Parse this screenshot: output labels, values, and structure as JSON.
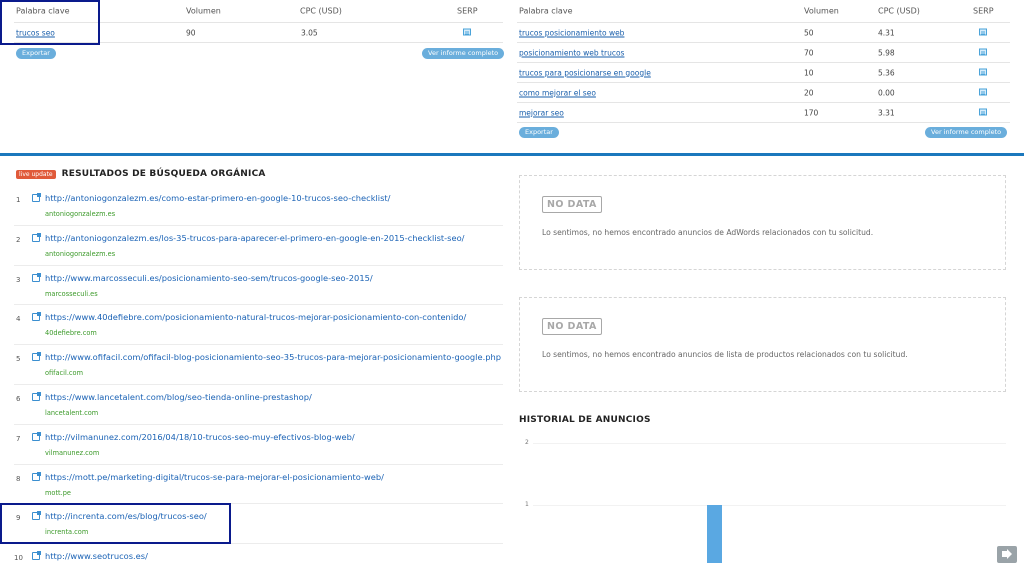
{
  "left_table": {
    "headers": {
      "keyword": "Palabra clave",
      "volume": "Volumen",
      "cpc": "CPC (USD)",
      "serp": "SERP"
    },
    "rows": [
      {
        "keyword": "trucos seo",
        "volume": "90",
        "cpc": "3.05"
      }
    ],
    "export_label": "Exportar",
    "report_label": "Ver informe completo"
  },
  "right_table": {
    "headers": {
      "keyword": "Palabra clave",
      "volume": "Volumen",
      "cpc": "CPC (USD)",
      "serp": "SERP"
    },
    "rows": [
      {
        "keyword": "trucos posicionamiento web",
        "volume": "50",
        "cpc": "4.31"
      },
      {
        "keyword": "posicionamiento web trucos",
        "volume": "70",
        "cpc": "5.98"
      },
      {
        "keyword": "trucos para posicionarse en google",
        "volume": "10",
        "cpc": "5.36"
      },
      {
        "keyword": "como mejorar el seo",
        "volume": "20",
        "cpc": "0.00"
      },
      {
        "keyword": "mejorar seo",
        "volume": "170",
        "cpc": "3.31"
      }
    ],
    "export_label": "Exportar",
    "report_label": "Ver informe completo"
  },
  "organic": {
    "badge": "live update",
    "title": "RESULTADOS DE BÚSQUEDA ORGÁNICA",
    "results": [
      {
        "num": "1",
        "url": "http://antoniogonzalezm.es/como-estar-primero-en-google-10-trucos-seo-checklist/",
        "domain": "antoniogonzalezm.es"
      },
      {
        "num": "2",
        "url": "http://antoniogonzalezm.es/los-35-trucos-para-aparecer-el-primero-en-google-en-2015-checklist-seo/",
        "domain": "antoniogonzalezm.es"
      },
      {
        "num": "3",
        "url": "http://www.marcosseculi.es/posicionamiento-seo-sem/trucos-google-seo-2015/",
        "domain": "marcosseculi.es"
      },
      {
        "num": "4",
        "url": "https://www.40defiebre.com/posicionamiento-natural-trucos-mejorar-posicionamiento-con-contenido/",
        "domain": "40defiebre.com"
      },
      {
        "num": "5",
        "url": "http://www.ofifacil.com/ofifacil-blog-posicionamiento-seo-35-trucos-para-mejorar-posicionamiento-google.php",
        "domain": "ofifacil.com"
      },
      {
        "num": "6",
        "url": "https://www.lancetalent.com/blog/seo-tienda-online-prestashop/",
        "domain": "lancetalent.com"
      },
      {
        "num": "7",
        "url": "http://vilmanunez.com/2016/04/18/10-trucos-seo-muy-efectivos-blog-web/",
        "domain": "vilmanunez.com"
      },
      {
        "num": "8",
        "url": "https://mott.pe/marketing-digital/trucos-se-para-mejorar-el-posicionamiento-web/",
        "domain": "mott.pe"
      },
      {
        "num": "9",
        "url": "http://increnta.com/es/blog/trucos-seo/",
        "domain": "increnta.com"
      },
      {
        "num": "10",
        "url": "http://www.seotrucos.es/",
        "domain": ""
      }
    ]
  },
  "adwords_panel": {
    "stamp": "NO DATA",
    "message": "Lo sentimos, no hemos encontrado anuncios de AdWords relacionados con tu solicitud."
  },
  "products_panel": {
    "stamp": "NO DATA",
    "message": "Lo sentimos, no hemos encontrado anuncios de lista de productos relacionados con tu solicitud."
  },
  "history": {
    "title": "HISTORIAL DE ANUNCIOS",
    "y_ticks": [
      "2",
      "1"
    ]
  },
  "chart_data": {
    "type": "bar",
    "title": "HISTORIAL DE ANUNCIOS",
    "ylim": [
      0,
      2
    ],
    "y_ticks": [
      2,
      1
    ],
    "categories": [
      ""
    ],
    "values": [
      1
    ],
    "colors": {
      "bar": "#5aa8e2"
    }
  },
  "colors": {
    "accent": "#1b78bd",
    "link": "#1a62b5",
    "domain_green": "#3c9a2a",
    "badge": "#e05a3a",
    "highlight_box": "#0a1a8c"
  }
}
